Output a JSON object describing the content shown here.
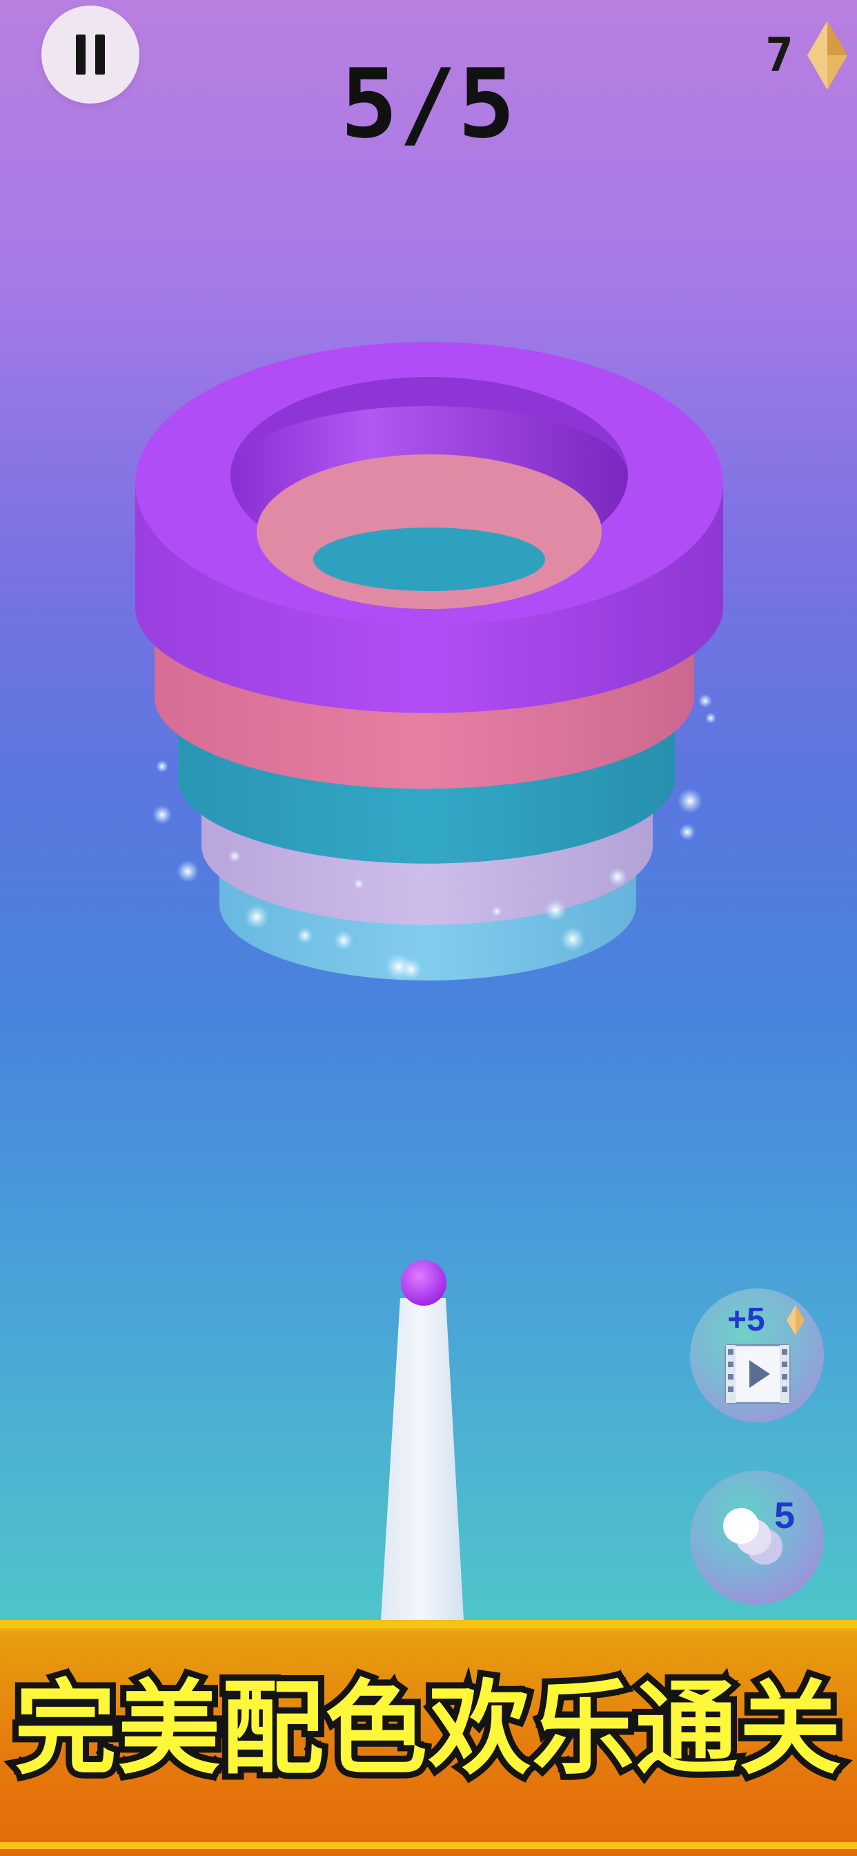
{
  "hud": {
    "score": "5/5",
    "gem_count": "7",
    "icons": {
      "pause": "pause-icon",
      "gem": "diamond-icon"
    }
  },
  "tower_rings": [
    {
      "color": "#ac48f0"
    },
    {
      "color": "#e57aa0"
    },
    {
      "color": "#2fa4c2"
    },
    {
      "color": "#c7b6e6"
    },
    {
      "color": "#77c6e6"
    }
  ],
  "shooter": {
    "ball_color": "#b237f5"
  },
  "side_buttons": {
    "video_reward_label": "+5",
    "extra_balls_count": "5"
  },
  "banner": {
    "text": "完美配色欢乐通关"
  },
  "colors": {
    "background_top": "#b87fe0",
    "background_bottom": "#55cfc4",
    "banner_orange": "#e5790c",
    "banner_text": "#fff83a"
  }
}
